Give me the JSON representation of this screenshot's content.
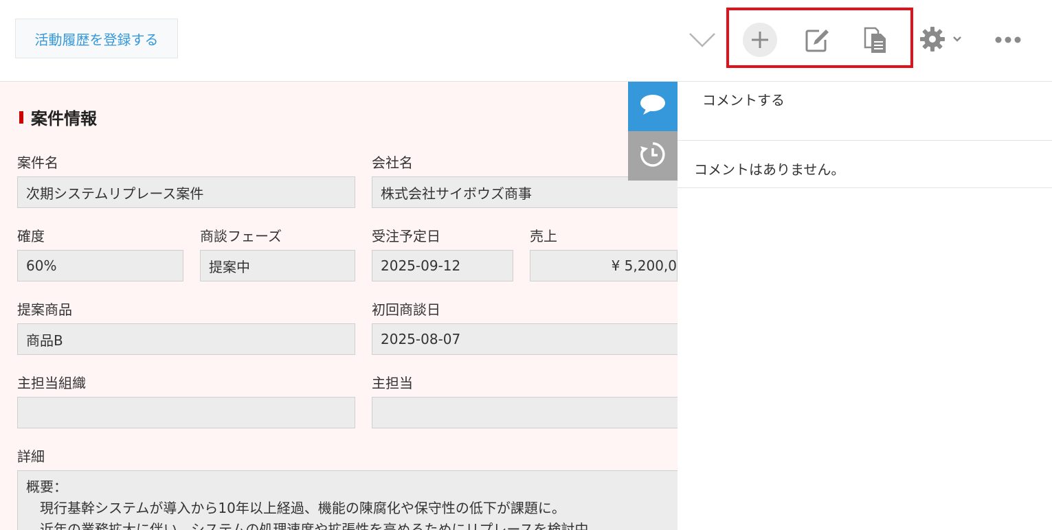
{
  "header": {
    "register_button_label": "活動履歴を登録する",
    "icons": {
      "collapse": "chevron-down-icon",
      "add": "plus-icon",
      "edit": "edit-icon",
      "copy": "copy-document-icon",
      "settings": "gear-icon",
      "settings_caret": "chevron-down-icon",
      "more": "more-horizontal-icon"
    },
    "highlight_color": "#e1101a"
  },
  "record": {
    "section_title": "案件情報",
    "section_marker_color": "#cc0000",
    "background_color": "#fff5f5",
    "fields": {
      "case_name": {
        "label": "案件名",
        "value": "次期システムリプレース案件"
      },
      "company": {
        "label": "会社名",
        "value": "株式会社サイボウズ商事"
      },
      "probability": {
        "label": "確度",
        "value": "60%"
      },
      "phase": {
        "label": "商談フェーズ",
        "value": "提案中"
      },
      "order_date": {
        "label": "受注予定日",
        "value": "2025-09-12"
      },
      "sales": {
        "label": "売上",
        "value": "¥ 5,200,0"
      },
      "product": {
        "label": "提案商品",
        "value": "商品B"
      },
      "first_meeting": {
        "label": "初回商談日",
        "value": "2025-08-07"
      },
      "org": {
        "label": "主担当組織",
        "value": ""
      },
      "owner": {
        "label": "主担当",
        "value": ""
      },
      "detail": {
        "label": "詳細",
        "lines": [
          "概要：",
          "　現行基幹システムが導入から10年以上経過、機能の陳腐化や保守性の低下が課題に。",
          "　近年の業務拡大に伴い、システムの処理速度や拡張性を高めるためにリプレースを検討中。"
        ]
      }
    }
  },
  "side_tabs": {
    "comments_icon": "speech-bubble-icon",
    "history_icon": "history-clock-icon",
    "comments_color": "#3498db",
    "history_color": "#a5a5a5"
  },
  "comments": {
    "input_placeholder": "コメントする",
    "empty_message": "コメントはありません。"
  }
}
